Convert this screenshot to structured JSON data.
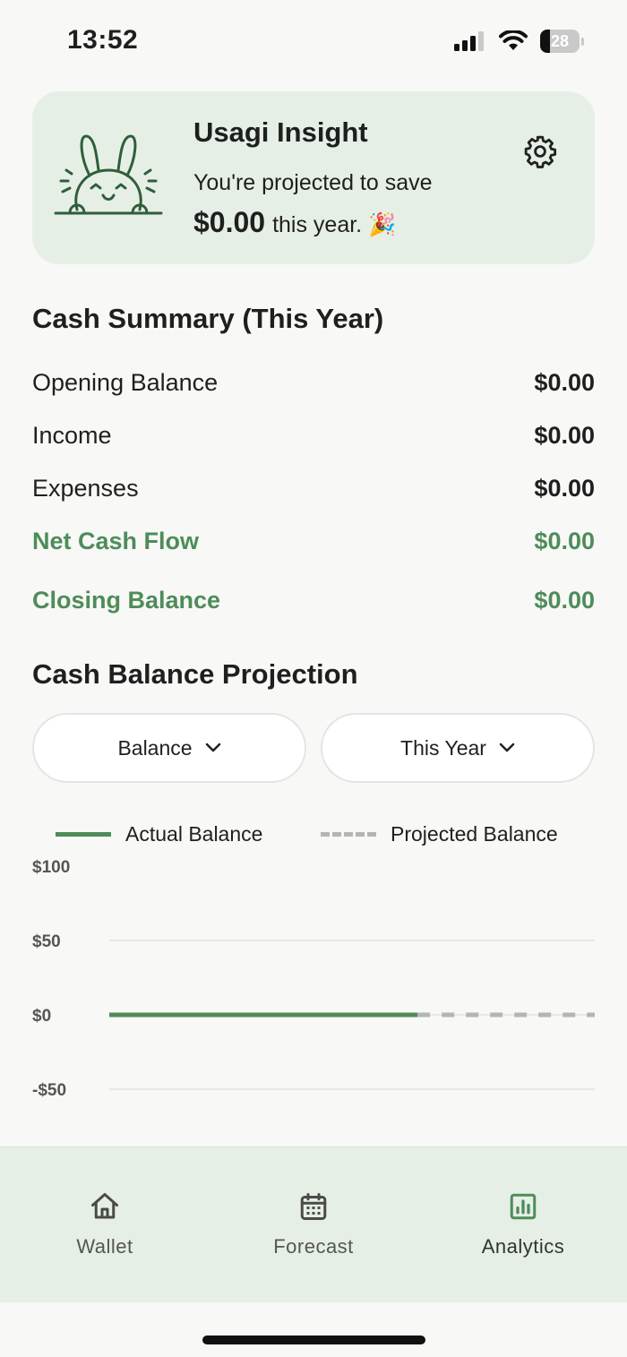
{
  "status_bar": {
    "time": "13:52",
    "battery": "28"
  },
  "insight": {
    "title": "Usagi Insight",
    "line1": "You're projected to save",
    "amount": "$0.00",
    "line2_suffix": "this year. 🎉"
  },
  "cash_summary": {
    "title": "Cash Summary (This Year)",
    "rows": [
      {
        "label": "Opening Balance",
        "value": "$0.00"
      },
      {
        "label": "Income",
        "value": "$0.00"
      },
      {
        "label": "Expenses",
        "value": "$0.00"
      },
      {
        "label": "Net Cash Flow",
        "value": "$0.00"
      },
      {
        "label": "Closing Balance",
        "value": "$0.00"
      }
    ]
  },
  "projection": {
    "title": "Cash Balance Projection",
    "metric_select": "Balance",
    "period_select": "This Year"
  },
  "colors": {
    "accent": "#4e8c5a",
    "card_bg": "#e6efe5",
    "projected": "#b5b5b5"
  },
  "chart_data": {
    "type": "line",
    "series": [
      {
        "name": "Actual Balance",
        "style": "solid",
        "x": [
          0,
          0.635
        ],
        "values": [
          0,
          0
        ]
      },
      {
        "name": "Projected Balance",
        "style": "dashed",
        "x": [
          0.635,
          1
        ],
        "values": [
          0,
          0
        ]
      }
    ],
    "y_ticks": [
      "$100",
      "$50",
      "$0",
      "-$50"
    ],
    "y_tick_values": [
      100,
      50,
      0,
      -50
    ],
    "ylim": [
      -50,
      100
    ],
    "legend_position": "top"
  },
  "nav": {
    "items": [
      {
        "label": "Wallet",
        "icon": "home-icon"
      },
      {
        "label": "Forecast",
        "icon": "calendar-icon"
      },
      {
        "label": "Analytics",
        "icon": "chart-icon",
        "active": true
      }
    ]
  }
}
